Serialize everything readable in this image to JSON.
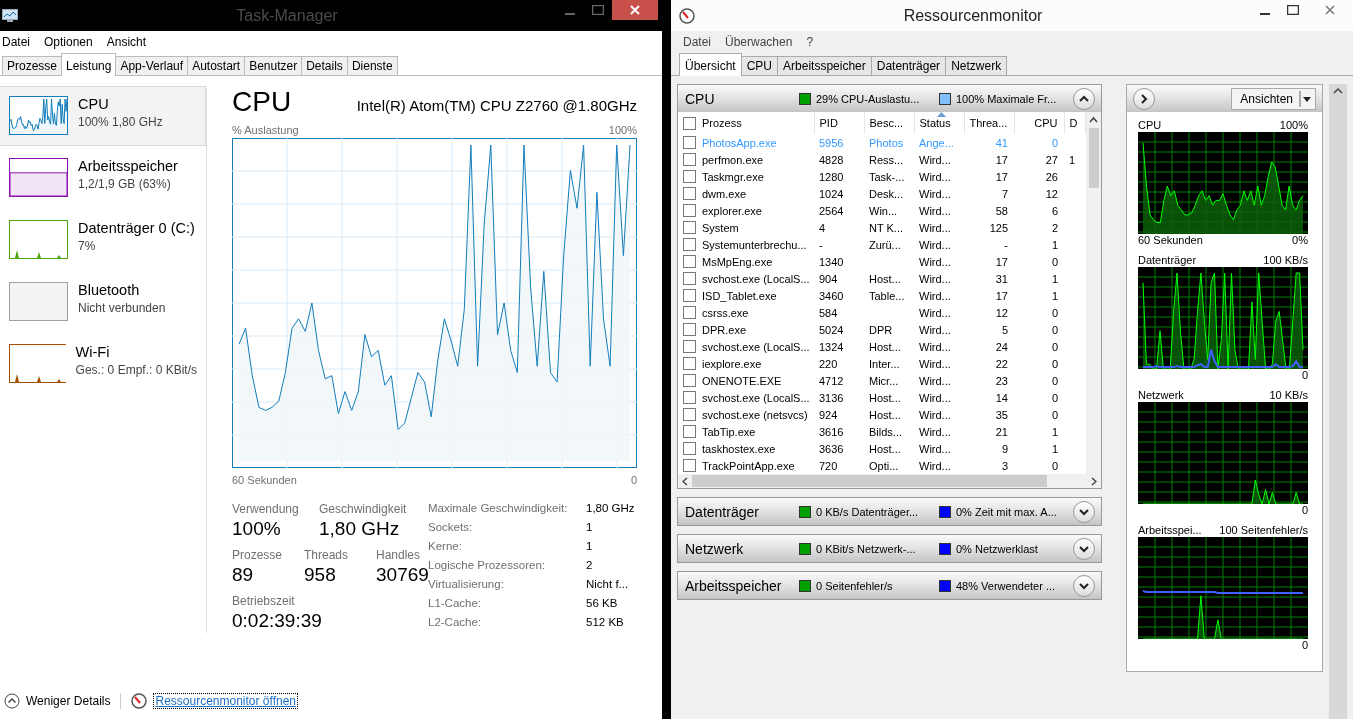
{
  "task_manager": {
    "title": "Task-Manager",
    "menu": [
      "Datei",
      "Optionen",
      "Ansicht"
    ],
    "tabs": [
      {
        "label": "Prozesse",
        "selected": false
      },
      {
        "label": "Leistung",
        "selected": true
      },
      {
        "label": "App-Verlauf",
        "selected": false
      },
      {
        "label": "Autostart",
        "selected": false
      },
      {
        "label": "Benutzer",
        "selected": false
      },
      {
        "label": "Details",
        "selected": false
      },
      {
        "label": "Dienste",
        "selected": false
      }
    ],
    "sidebar": [
      {
        "kind": "line",
        "name": "CPU",
        "detail": "100% 1,80 GHz",
        "color": "#117dbb",
        "selected": true
      },
      {
        "kind": "fill",
        "name": "Arbeitsspeicher",
        "detail": "1,2/1,9 GB (63%)",
        "color": "#8b12ae",
        "selected": false
      },
      {
        "kind": "spikes",
        "name": "Datenträger 0 (C:)",
        "detail": "7%",
        "color": "#4da60c",
        "selected": false
      },
      {
        "kind": "empty",
        "name": "Bluetooth",
        "detail": "Nicht verbunden",
        "color": "#a0a0a0",
        "selected": false
      },
      {
        "kind": "spikes",
        "name": "Wi-Fi",
        "detail": "Ges.: 0 Empf.: 0 KBit/s",
        "color": "#a74f01",
        "selected": false
      }
    ],
    "heading": "CPU",
    "model": "Intel(R) Atom(TM) CPU Z2760 @1.80GHz",
    "graph": {
      "label": "% Auslastung",
      "max": "100%",
      "span": "60 Sekunden",
      "min": "0"
    },
    "stats": [
      [
        {
          "label": "Verwendung",
          "value": "100%"
        },
        {
          "label": "Geschwindigkeit",
          "value": "1,80 GHz"
        }
      ],
      [
        {
          "label": "Prozesse",
          "value": "89"
        },
        {
          "label": "Threads",
          "value": "958"
        },
        {
          "label": "Handles",
          "value": "30769"
        }
      ],
      [
        {
          "label": "Betriebszeit",
          "value": "0:02:39:39"
        }
      ]
    ],
    "details": [
      {
        "label": "Maximale Geschwindigkeit:",
        "value": "1,80 GHz"
      },
      {
        "label": "Sockets:",
        "value": "1"
      },
      {
        "label": "Kerne:",
        "value": "1"
      },
      {
        "label": "Logische Prozessoren:",
        "value": "2"
      },
      {
        "label": "Virtualisierung:",
        "value": "Nicht f..."
      },
      {
        "label": "L1-Cache:",
        "value": "56 KB"
      },
      {
        "label": "L2-Cache:",
        "value": "512 KB"
      }
    ],
    "footer": {
      "toggle": "Weniger Details",
      "link": "Ressourcenmonitor öffnen"
    }
  },
  "resource_monitor": {
    "title": "Ressourcenmonitor",
    "menu": [
      "Datei",
      "Überwachen",
      "?"
    ],
    "tabs": [
      {
        "label": "Übersicht",
        "selected": true
      },
      {
        "label": "CPU",
        "selected": false
      },
      {
        "label": "Arbeitsspeicher",
        "selected": false
      },
      {
        "label": "Datenträger",
        "selected": false
      },
      {
        "label": "Netzwerk",
        "selected": false
      }
    ],
    "sections": [
      {
        "title": "CPU",
        "expanded": true,
        "legend": [
          {
            "color": "#00a000",
            "text": "29% CPU-Auslastu..."
          },
          {
            "color": "#80c0ff",
            "text": "100% Maximale Fr..."
          }
        ]
      },
      {
        "title": "Datenträger",
        "expanded": false,
        "legend": [
          {
            "color": "#00a000",
            "text": "0 KB/s Datenträger..."
          },
          {
            "color": "#0000ff",
            "text": "0% Zeit mit max. A..."
          }
        ]
      },
      {
        "title": "Netzwerk",
        "expanded": false,
        "legend": [
          {
            "color": "#00a000",
            "text": "0 KBit/s Netzwerk-..."
          },
          {
            "color": "#0000ff",
            "text": "0% Netzwerklast"
          }
        ]
      },
      {
        "title": "Arbeitsspeicher",
        "expanded": false,
        "legend": [
          {
            "color": "#00a000",
            "text": "0 Seitenfehler/s"
          },
          {
            "color": "#0000ff",
            "text": "48% Verwendeter ..."
          }
        ]
      }
    ],
    "table": {
      "columns": [
        {
          "label": "Prozess",
          "sorted": false
        },
        {
          "label": "PID",
          "sorted": false
        },
        {
          "label": "Besc...",
          "sorted": false
        },
        {
          "label": "Status",
          "sorted": true
        },
        {
          "label": "Threa...",
          "sorted": false
        },
        {
          "label": "CPU",
          "sorted": false
        },
        {
          "label": "D",
          "sorted": false
        }
      ],
      "header_checked": false,
      "rows": [
        {
          "checked": false,
          "suspended": true,
          "cells": [
            "PhotosApp.exe",
            "5956",
            "Photos",
            "Ange...",
            "41",
            "0",
            null
          ]
        },
        {
          "checked": false,
          "suspended": false,
          "cells": [
            "perfmon.exe",
            "4828",
            "Ress...",
            "Wird...",
            "17",
            "27",
            "1"
          ]
        },
        {
          "checked": false,
          "suspended": false,
          "cells": [
            "Taskmgr.exe",
            "1280",
            "Task-...",
            "Wird...",
            "17",
            "26",
            null
          ]
        },
        {
          "checked": false,
          "suspended": false,
          "cells": [
            "dwm.exe",
            "1024",
            "Desk...",
            "Wird...",
            "7",
            "12",
            null
          ]
        },
        {
          "checked": false,
          "suspended": false,
          "cells": [
            "explorer.exe",
            "2564",
            "Win...",
            "Wird...",
            "58",
            "6",
            null
          ]
        },
        {
          "checked": false,
          "suspended": false,
          "cells": [
            "System",
            "4",
            "NT K...",
            "Wird...",
            "125",
            "2",
            null
          ]
        },
        {
          "checked": false,
          "suspended": false,
          "cells": [
            "Systemunterbrechu...",
            "-",
            "Zurü...",
            "Wird...",
            "-",
            "1",
            null
          ]
        },
        {
          "checked": false,
          "suspended": false,
          "cells": [
            "MsMpEng.exe",
            "1340",
            null,
            "Wird...",
            "17",
            "0",
            null
          ]
        },
        {
          "checked": false,
          "suspended": false,
          "cells": [
            "svchost.exe (LocalS...",
            "904",
            "Host...",
            "Wird...",
            "31",
            "1",
            null
          ]
        },
        {
          "checked": false,
          "suspended": false,
          "cells": [
            "ISD_Tablet.exe",
            "3460",
            "Table...",
            "Wird...",
            "17",
            "1",
            null
          ]
        },
        {
          "checked": false,
          "suspended": false,
          "cells": [
            "csrss.exe",
            "584",
            null,
            "Wird...",
            "12",
            "0",
            null
          ]
        },
        {
          "checked": false,
          "suspended": false,
          "cells": [
            "DPR.exe",
            "5024",
            "DPR",
            "Wird...",
            "5",
            "0",
            null
          ]
        },
        {
          "checked": false,
          "suspended": false,
          "cells": [
            "svchost.exe (LocalS...",
            "1324",
            "Host...",
            "Wird...",
            "24",
            "0",
            null
          ]
        },
        {
          "checked": false,
          "suspended": false,
          "cells": [
            "iexplore.exe",
            "220",
            "Inter...",
            "Wird...",
            "22",
            "0",
            null
          ]
        },
        {
          "checked": false,
          "suspended": false,
          "cells": [
            "ONENOTE.EXE",
            "4712",
            "Micr...",
            "Wird...",
            "23",
            "0",
            null
          ]
        },
        {
          "checked": false,
          "suspended": false,
          "cells": [
            "svchost.exe (LocalS...",
            "3136",
            "Host...",
            "Wird...",
            "14",
            "0",
            null
          ]
        },
        {
          "checked": false,
          "suspended": false,
          "cells": [
            "svchost.exe (netsvcs)",
            "924",
            "Host...",
            "Wird...",
            "35",
            "0",
            null
          ]
        },
        {
          "checked": false,
          "suspended": false,
          "cells": [
            "TabTip.exe",
            "3616",
            "Bilds...",
            "Wird...",
            "21",
            "1",
            null
          ]
        },
        {
          "checked": false,
          "suspended": false,
          "cells": [
            "taskhostex.exe",
            "3636",
            "Host...",
            "Wird...",
            "9",
            "1",
            null
          ]
        },
        {
          "checked": false,
          "suspended": false,
          "cells": [
            "TrackPointApp.exe",
            "720",
            "Opti...",
            "Wird...",
            "3",
            "0",
            null
          ]
        }
      ]
    },
    "side_panel": {
      "button": "Ansichten",
      "graphs": [
        {
          "title": "CPU",
          "max": "100%",
          "span": "60 Sekunden",
          "min": "0%"
        },
        {
          "title": "Datenträger",
          "max": "100 KB/s",
          "min": "0"
        },
        {
          "title": "Netzwerk",
          "max": "10 KB/s",
          "min": "0"
        },
        {
          "title": "Arbeitsspei...",
          "max": "100 Seitenfehler/s",
          "min": "0"
        }
      ]
    }
  }
}
